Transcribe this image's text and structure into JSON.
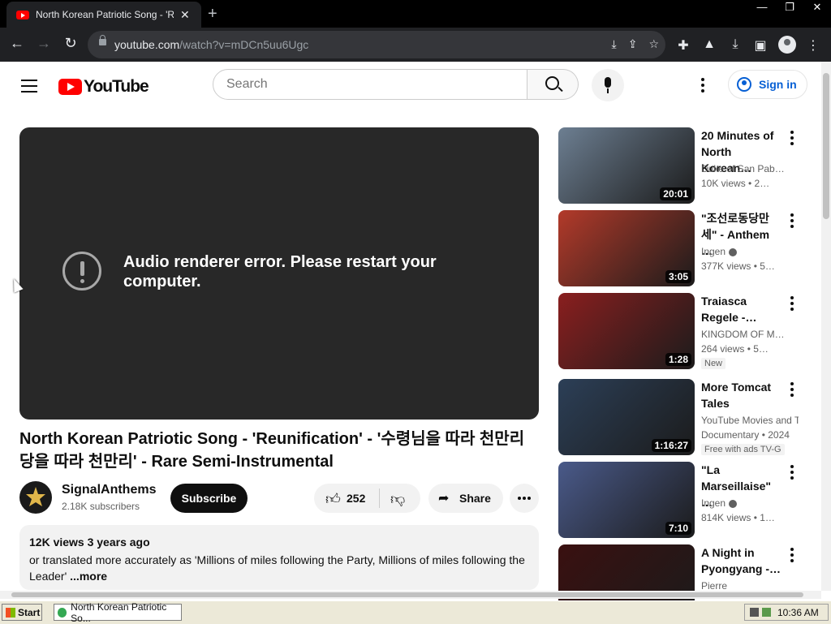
{
  "browser": {
    "tab_title": "North Korean Patriotic Song - 'Reun",
    "tab_close": "✕",
    "new_tab": "+",
    "win_minimize": "—",
    "win_restore": "❐",
    "win_close": "✕",
    "url_host": "youtube.com",
    "url_path": "/watch?v=mDCn5uu6Ugc"
  },
  "youtube": {
    "logo_text": "YouTube",
    "search_placeholder": "Search",
    "sign_in": "Sign in"
  },
  "player": {
    "error_message": "Audio renderer error. Please restart your computer."
  },
  "video": {
    "title": "North Korean Patriotic Song - 'Reunification' - '수령님을 따라 천만리 당을 따라 천만리' - Rare Semi-Instrumental",
    "channel": "SignalAnthems",
    "subscribers": "2.18K subscribers",
    "subscribe_label": "Subscribe",
    "likes": "252",
    "share_label": "Share",
    "views_date": "12K views  3 years ago",
    "description": "or translated more accurately as 'Millions of miles following the Party, Millions of miles following the Leader' ",
    "more_label": "...more"
  },
  "recommendations": [
    {
      "title": "20 Minutes of North Korean…",
      "channel": "Duke of San Pab…",
      "views": "10K views  •  2…",
      "badge": "",
      "duration": "20:01",
      "thumb_color": "#6d7f92",
      "verified": false
    },
    {
      "title": "\"조선로동당만세\" - Anthem …",
      "channel": "Ingen",
      "views": "377K views  •  5…",
      "badge": "",
      "duration": "3:05",
      "thumb_color": "#b33a2a",
      "verified": true
    },
    {
      "title": "Traiasca Regele -…",
      "channel": "KINGDOM OF M…",
      "views": "264 views  •  5…",
      "badge": "New",
      "duration": "1:28",
      "thumb_color": "#8a1f1f",
      "verified": false
    },
    {
      "title": "More Tomcat Tales",
      "channel": "YouTube Movies and TV",
      "views": "Documentary • 2024",
      "badge": "Free with ads   TV-G",
      "duration": "1:16:27",
      "thumb_color": "#2c3f57",
      "verified": false
    },
    {
      "title": "\"La Marseillaise\" …",
      "channel": "Ingen",
      "views": "814K views  •  1…",
      "badge": "",
      "duration": "7:10",
      "thumb_color": "#4a5a8a",
      "verified": true
    },
    {
      "title": "A Night in Pyongyang -…",
      "channel": "Pierre",
      "views": "",
      "badge": "",
      "duration": "",
      "thumb_color": "#3a1010",
      "verified": false
    }
  ],
  "taskbar": {
    "start": "Start",
    "window_item": "North Korean Patriotic So...",
    "clock": "10:36 AM"
  },
  "colors": {
    "youtube_red": "#ff0000",
    "link_blue": "#065fd4",
    "player_bg": "#282828"
  }
}
